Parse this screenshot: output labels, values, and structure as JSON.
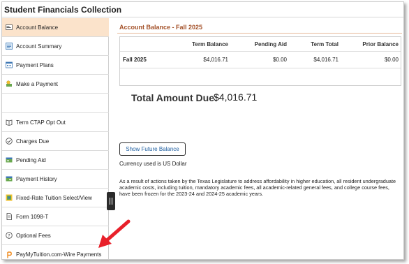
{
  "app": {
    "title": "Student Financials Collection"
  },
  "sidebar": {
    "items": [
      {
        "label": "Account Balance",
        "icon": "account-balance-icon",
        "active": true
      },
      {
        "label": "Account Summary",
        "icon": "account-summary-icon"
      },
      {
        "label": "Payment Plans",
        "icon": "payment-plans-icon"
      },
      {
        "label": "Make a Payment",
        "icon": "make-payment-icon"
      },
      {
        "label": "Term CTAP Opt Out",
        "icon": "book-icon"
      },
      {
        "label": "Charges Due",
        "icon": "check-circle-icon"
      },
      {
        "label": "Pending Aid",
        "icon": "pending-aid-icon"
      },
      {
        "label": "Payment History",
        "icon": "payment-history-icon"
      },
      {
        "label": "Fixed-Rate Tuition Select/View",
        "icon": "fixed-rate-icon"
      },
      {
        "label": "Form 1098-T",
        "icon": "document-icon"
      },
      {
        "label": "Optional Fees",
        "icon": "question-circle-icon"
      },
      {
        "label": "PayMyTuition.com-Wire Payments",
        "icon": "paymytuition-logo-icon"
      }
    ]
  },
  "main": {
    "section_title": "Account Balance - Fall 2025",
    "table": {
      "headers": [
        "",
        "Term Balance",
        "Pending Aid",
        "Term Total",
        "Prior Balance"
      ],
      "rows": [
        [
          "Fall 2025",
          "$4,016.71",
          "$0.00",
          "$4,016.71",
          "$0.00"
        ]
      ]
    },
    "total_label": "Total Amount Due:",
    "total_value": "$4,016.71",
    "future_balance_button": "Show Future Balance",
    "currency_note": "Currency used is US Dollar",
    "legislature_note": "As a result of actions taken by the Texas Legislature to address affordability in higher education, all resident undergraduate academic costs, including tuition, mandatory academic fees, all academic-related general fees, and college course fees, have been frozen for the 2023-24 and 2024-25 academic years."
  },
  "colors": {
    "active_bg": "#fbe3cb",
    "section_title": "#a4522a",
    "button_text": "#1f5fa0",
    "arrow": "#e8202a"
  }
}
